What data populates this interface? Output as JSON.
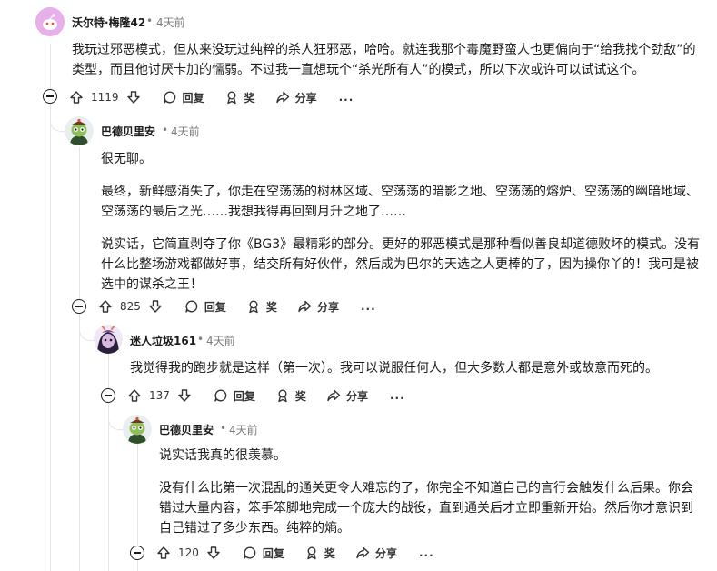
{
  "comments": [
    {
      "author": "沃尔特·梅隆42",
      "time": "4天前",
      "paragraphs": [
        "我玩过邪恶模式，但从来没玩过纯粹的杀人狂邪恶，哈哈。就连我那个毒魔野蛮人也更偏向于“给我找个劲敌”的类型，而且他讨厌卡加的懦弱。不过我一直想玩个“杀光所有人”的模式，所以下次或许可以试试这个。"
      ],
      "votes": "1119"
    },
    {
      "author": "巴德贝里安",
      "time": "4天前",
      "paragraphs": [
        "很无聊。",
        "最终，新鲜感消失了，你走在空荡荡的树林区域、空荡荡的暗影之地、空荡荡的熔炉、空荡荡的幽暗地域、空荡荡的最后之光……我想我得再回到月升之地了……",
        "说实话，它简直剥夺了你《BG3》最精彩的部分。更好的邪恶模式是那种看似善良却道德败坏的模式。没有什么比整场游戏都做好事，结交所有好伙伴，然后成为巴尔的天选之人更棒的了，因为操你丫的！我可是被选中的谋杀之王！"
      ],
      "votes": "825"
    },
    {
      "author": "迷人垃圾161",
      "time": "4天前",
      "paragraphs": [
        "我觉得我的跑步就是这样（第一次）。我可以说服任何人，但大多数人都是意外或故意而死的。"
      ],
      "votes": "137"
    },
    {
      "author": "巴德贝里安",
      "time": "4天前",
      "paragraphs": [
        "说实话我真的很羡慕。",
        "没有什么比第一次混乱的通关更令人难忘的了，你完全不知道自己的言行会触发什么后果。你会错过大量内容，笨手笨脚地完成一个庞大的战役，直到通关后才立即重新开始。然后你才意识到自己错过了多少东西。纯粹的熵。"
      ],
      "votes": "120"
    }
  ],
  "actions": {
    "reply": "回复",
    "award": "奖",
    "share": "分享",
    "more": "..."
  },
  "separator": "•",
  "colors": {
    "text": "#1a1a1b",
    "meta": "#7c7c7c",
    "thread": "#e3e6e8",
    "avatar1": "#e6a6e6",
    "avatar2": "#4a6b3a"
  }
}
